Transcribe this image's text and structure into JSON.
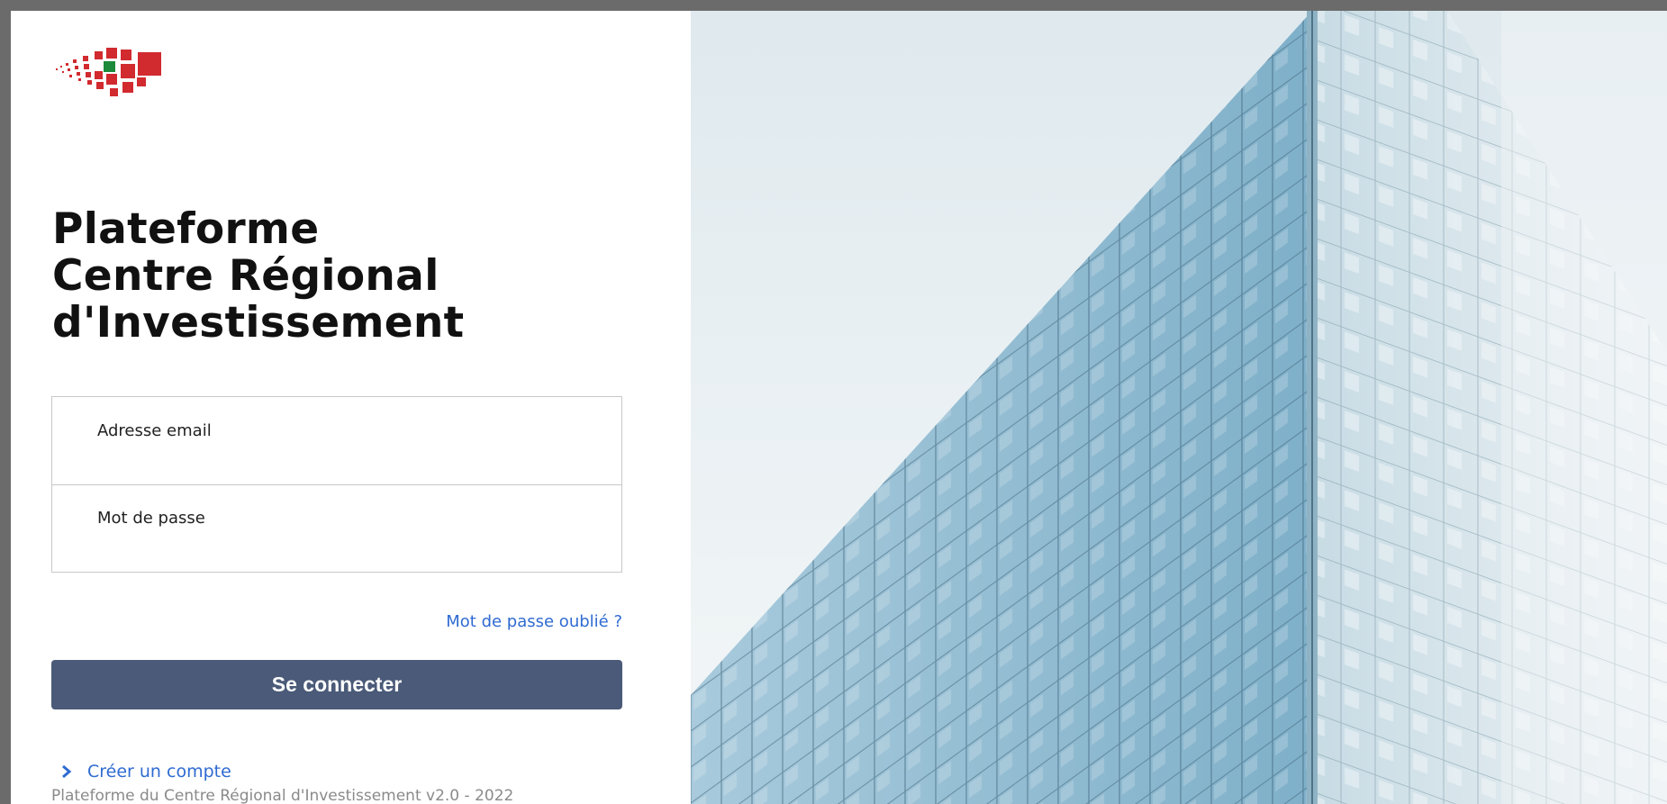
{
  "brand": {
    "title_lines": [
      "Plateforme",
      "Centre Régional",
      "d'Investissement"
    ],
    "logo_colors": {
      "red": "#d12a2f",
      "green": "#1c8a3a"
    }
  },
  "form": {
    "email": {
      "label": "Adresse email",
      "value": ""
    },
    "password": {
      "label": "Mot de passe",
      "value": ""
    },
    "forgot_label": "Mot de passe oublié ?",
    "submit_label": "Se connecter"
  },
  "links": {
    "create_account_label": "Créer un compte"
  },
  "footer": {
    "text": "Plateforme du Centre Régional d'Investissement v2.0 - 2022"
  },
  "theme": {
    "button_color": "#4a5a78",
    "link_color": "#2f6bd1"
  }
}
